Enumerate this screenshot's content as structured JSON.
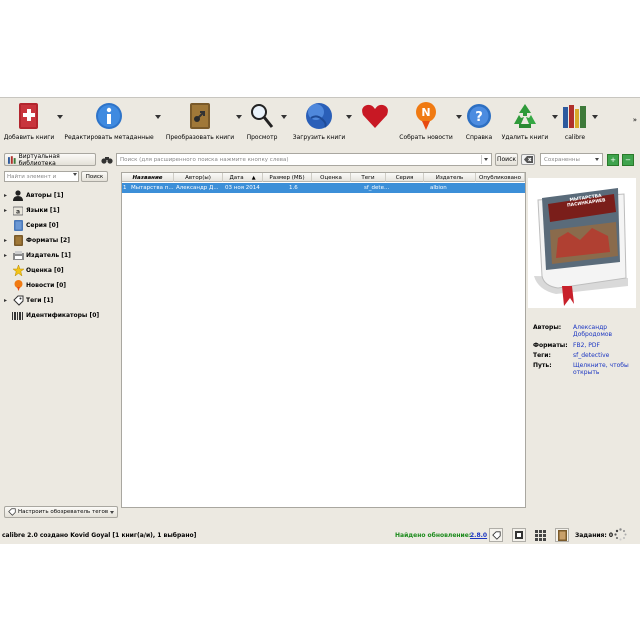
{
  "toolbar": {
    "buttons": [
      {
        "label": "Добавить книги",
        "icon": "add-book-icon"
      },
      {
        "label": "Редактировать метаданные",
        "icon": "edit-metadata-icon"
      },
      {
        "label": "Преобразовать книги",
        "icon": "convert-books-icon"
      },
      {
        "label": "Просмотр",
        "icon": "view-magnifier-icon"
      },
      {
        "label": "Загрузить книги",
        "icon": "download-globe-icon"
      },
      {
        "label": "",
        "icon": "heart-icon"
      },
      {
        "label": "Собрать новости",
        "icon": "fetch-news-icon"
      },
      {
        "label": "Справка",
        "icon": "help-icon"
      },
      {
        "label": "Удалить книги",
        "icon": "remove-books-icon"
      },
      {
        "label": "calibre",
        "icon": "calibre-library-icon"
      }
    ],
    "more": "»"
  },
  "searchbar": {
    "virtual_library": "Виртуальная библиотека",
    "search_placeholder": "Поиск (для расширенного поиска нажмите кнопку слева)",
    "find_button": "Поиск",
    "saved_searches_placeholder": "Сохраненны"
  },
  "tag_browser": {
    "find_placeholder": "Найти элемент и",
    "find_button": "Поиск",
    "nodes": [
      {
        "label": "Авторы [1]",
        "icon": "authors-icon",
        "expandable": true
      },
      {
        "label": "Языки [1]",
        "icon": "languages-icon",
        "expandable": true
      },
      {
        "label": "Серия [0]",
        "icon": "series-icon",
        "expandable": false
      },
      {
        "label": "Форматы [2]",
        "icon": "formats-icon",
        "expandable": true
      },
      {
        "label": "Издатель [1]",
        "icon": "publisher-icon",
        "expandable": true
      },
      {
        "label": "Оценка [0]",
        "icon": "rating-star-icon",
        "expandable": false
      },
      {
        "label": "Новости [0]",
        "icon": "news-icon",
        "expandable": false
      },
      {
        "label": "Теги [1]",
        "icon": "tags-icon",
        "expandable": true
      },
      {
        "label": "Идентификаторы [0]",
        "icon": "identifiers-barcode-icon",
        "expandable": false
      }
    ],
    "configure_button": "Настроить обозреватель тегов"
  },
  "book_table": {
    "columns": [
      "Название",
      "Автор(ы)",
      "Дата",
      "Размер (МБ)",
      "Оценка",
      "Теги",
      "Серия",
      "Издатель",
      "Опубликовано"
    ],
    "rows": [
      {
        "num": "1",
        "title": "Мытарства п...",
        "author": "Александр Д...",
        "date": "03 ноя 2014",
        "size": "1.6",
        "rating": "",
        "tags": "sf_dete...",
        "series": "",
        "publisher": "albion",
        "published": ""
      }
    ]
  },
  "details": {
    "cover_title": "МЫТАРСТВА ПАСИНКАРИЕВ",
    "authors_label": "Авторы:",
    "authors_value": "Александр Добродомов",
    "formats_label": "Форматы:",
    "formats_value": "FB2, PDF",
    "tags_label": "Теги:",
    "tags_value": "sf_detective",
    "path_label": "Путь:",
    "path_value": "Щелкните, чтобы открыть"
  },
  "statusbar": {
    "left": "calibre 2.0 создано Kovid Goyal [1 книг(а/и), 1 выбрано]",
    "update_label": "Найдено обновление:",
    "update_version": "2.8.0",
    "jobs": "Задания: 0"
  }
}
